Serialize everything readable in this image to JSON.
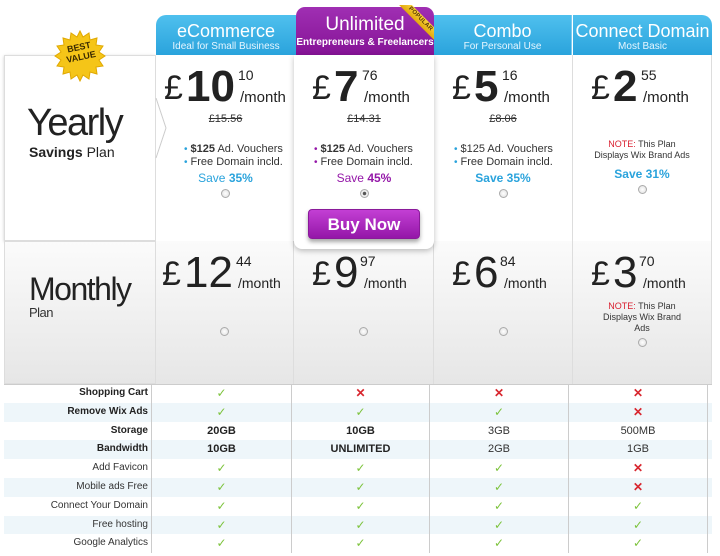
{
  "badge": {
    "text": "BEST VALUE"
  },
  "plans": [
    {
      "name": "eCommerce",
      "tagline": "Ideal for Small Business"
    },
    {
      "name": "Unlimited",
      "tagline": "Entrepreneurs & Freelancers",
      "ribbon": "POPULAR"
    },
    {
      "name": "Combo",
      "tagline": "For Personal Use"
    },
    {
      "name": "Connect Domain",
      "tagline": "Most Basic"
    }
  ],
  "yearly": {
    "title": "Yearly",
    "subtitle_bold": "Savings",
    "subtitle": "Plan",
    "prices": [
      {
        "currency": "£",
        "int": "10",
        "cents": "10",
        "per": "/month",
        "old": "£15.56",
        "features": [
          "$125 Ad. Vouchers",
          "Free Domain incld."
        ],
        "save_label": "Save",
        "save_pct": "35%",
        "selected": false
      },
      {
        "currency": "£",
        "int": "7",
        "cents": "76",
        "per": "/month",
        "old": "£14.31",
        "features": [
          "$125 Ad. Vouchers",
          "Free Domain incld."
        ],
        "save_label": "Save",
        "save_pct": "45%",
        "selected": true
      },
      {
        "currency": "£",
        "int": "5",
        "cents": "16",
        "per": "/month",
        "old": "£8.06",
        "features": [
          "$125 Ad. Vouchers",
          "Free Domain incld."
        ],
        "save_label": "Save",
        "save_pct": "35%",
        "selected": false
      },
      {
        "currency": "£",
        "int": "2",
        "cents": "55",
        "per": "/month",
        "note_label": "NOTE:",
        "note": "This Plan Displays Wix Brand Ads",
        "save_label": "Save",
        "save_pct": "31%",
        "selected": false
      }
    ],
    "buy_label": "Buy Now"
  },
  "monthly": {
    "title": "Monthly",
    "subtitle": "Plan",
    "prices": [
      {
        "currency": "£",
        "int": "12",
        "cents": "44",
        "per": "/month"
      },
      {
        "currency": "£",
        "int": "9",
        "cents": "97",
        "per": "/month"
      },
      {
        "currency": "£",
        "int": "6",
        "cents": "84",
        "per": "/month"
      },
      {
        "currency": "£",
        "int": "3",
        "cents": "70",
        "per": "/month",
        "note_label": "NOTE:",
        "note": "This Plan Displays Wix Brand Ads"
      }
    ]
  },
  "features": [
    {
      "label": "Shopping Cart",
      "bold": true,
      "values": [
        "check",
        "cross",
        "cross",
        "cross"
      ]
    },
    {
      "label": "Remove Wix Ads",
      "bold": true,
      "values": [
        "check",
        "check",
        "check",
        "cross"
      ]
    },
    {
      "label": "Storage",
      "bold": true,
      "values": [
        "20GB",
        "10GB",
        "3GB",
        "500MB"
      ]
    },
    {
      "label": "Bandwidth",
      "bold": true,
      "values": [
        "10GB",
        "UNLIMITED",
        "2GB",
        "1GB"
      ]
    },
    {
      "label": "Add Favicon",
      "bold": false,
      "values": [
        "check",
        "check",
        "check",
        "cross"
      ]
    },
    {
      "label": "Mobile ads Free",
      "bold": false,
      "values": [
        "check",
        "check",
        "check",
        "cross"
      ]
    },
    {
      "label": "Connect Your Domain",
      "bold": false,
      "values": [
        "check",
        "check",
        "check",
        "check"
      ]
    },
    {
      "label": "Free hosting",
      "bold": false,
      "values": [
        "check",
        "check",
        "check",
        "check"
      ]
    },
    {
      "label": "Google Analytics",
      "bold": false,
      "values": [
        "check",
        "check",
        "check",
        "check"
      ]
    }
  ],
  "colors": {
    "blue": "#2aa3dc",
    "purple": "#9417a8",
    "check": "#7cc33c",
    "cross": "#d8262e"
  }
}
